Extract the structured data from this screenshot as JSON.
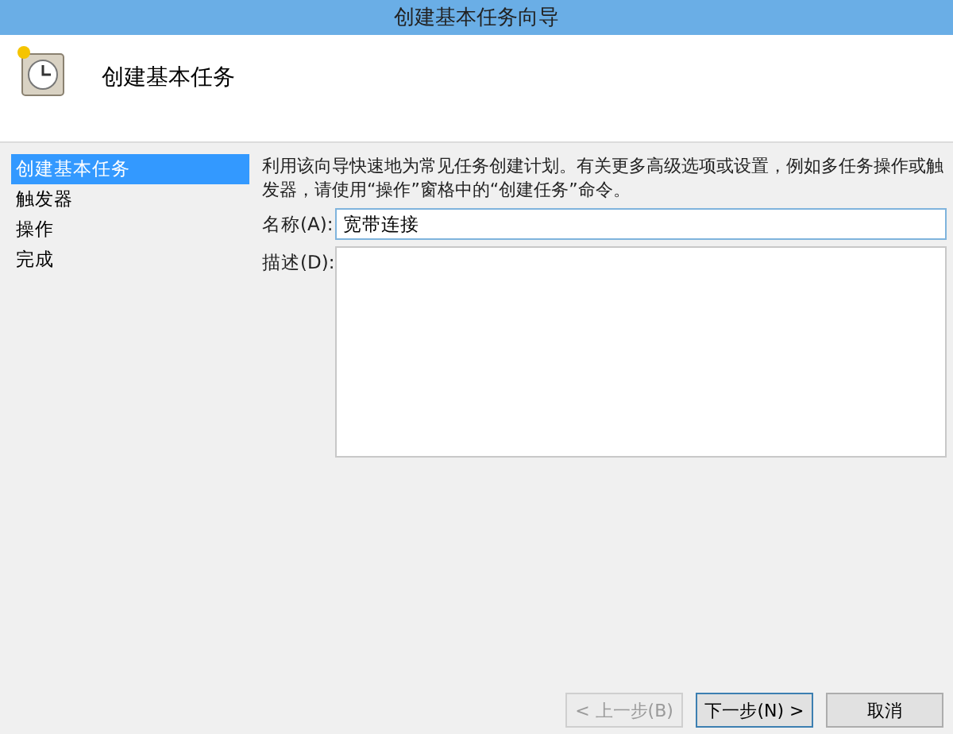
{
  "window": {
    "title": "创建基本任务向导"
  },
  "header": {
    "title": "创建基本任务"
  },
  "steps": [
    {
      "label": "创建基本任务",
      "selected": true
    },
    {
      "label": "触发器",
      "selected": false
    },
    {
      "label": "操作",
      "selected": false
    },
    {
      "label": "完成",
      "selected": false
    }
  ],
  "intro": "利用该向导快速地为常见任务创建计划。有关更多高级选项或设置，例如多任务操作或触发器，请使用“操作”窗格中的“创建任务”命令。",
  "name_field": {
    "label": "名称(A):",
    "value": "宽带连接"
  },
  "description_field": {
    "label": "描述(D):"
  },
  "buttons": [
    {
      "label": "< 上一步(B)",
      "disabled": true,
      "default": false
    },
    {
      "label": "下一步(N) >",
      "disabled": false,
      "default": true
    },
    {
      "label": "取消",
      "disabled": false,
      "default": false
    }
  ]
}
